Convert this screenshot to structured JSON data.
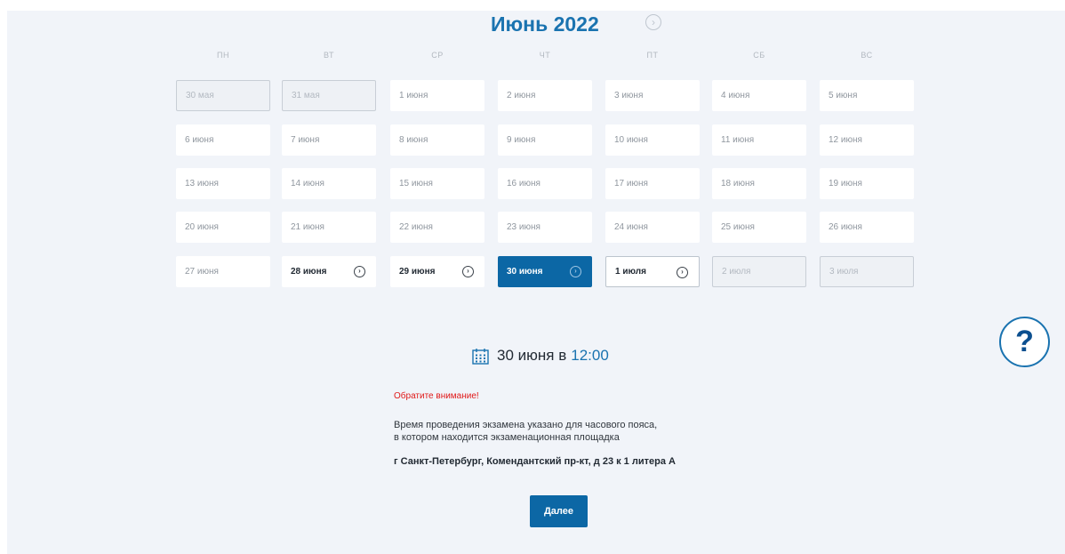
{
  "calendar": {
    "month_title": "Июнь 2022",
    "weekdays": [
      "ПН",
      "ВТ",
      "СР",
      "ЧТ",
      "ПТ",
      "СБ",
      "ВС"
    ],
    "weeks": [
      [
        {
          "label": "30 мая",
          "state": "disabled"
        },
        {
          "label": "31 мая",
          "state": "disabled"
        },
        {
          "label": "1 июня",
          "state": "unavailable"
        },
        {
          "label": "2 июня",
          "state": "unavailable"
        },
        {
          "label": "3 июня",
          "state": "unavailable"
        },
        {
          "label": "4 июня",
          "state": "unavailable"
        },
        {
          "label": "5 июня",
          "state": "unavailable"
        }
      ],
      [
        {
          "label": "6 июня",
          "state": "unavailable"
        },
        {
          "label": "7 июня",
          "state": "unavailable"
        },
        {
          "label": "8 июня",
          "state": "unavailable"
        },
        {
          "label": "9 июня",
          "state": "unavailable"
        },
        {
          "label": "10 июня",
          "state": "unavailable"
        },
        {
          "label": "11 июня",
          "state": "unavailable"
        },
        {
          "label": "12 июня",
          "state": "unavailable"
        }
      ],
      [
        {
          "label": "13 июня",
          "state": "unavailable"
        },
        {
          "label": "14 июня",
          "state": "unavailable"
        },
        {
          "label": "15 июня",
          "state": "unavailable"
        },
        {
          "label": "16 июня",
          "state": "unavailable"
        },
        {
          "label": "17 июня",
          "state": "unavailable"
        },
        {
          "label": "18 июня",
          "state": "unavailable"
        },
        {
          "label": "19 июня",
          "state": "unavailable"
        }
      ],
      [
        {
          "label": "20 июня",
          "state": "unavailable"
        },
        {
          "label": "21 июня",
          "state": "unavailable"
        },
        {
          "label": "22 июня",
          "state": "unavailable"
        },
        {
          "label": "23 июня",
          "state": "unavailable"
        },
        {
          "label": "24 июня",
          "state": "unavailable"
        },
        {
          "label": "25 июня",
          "state": "unavailable"
        },
        {
          "label": "26 июня",
          "state": "unavailable"
        }
      ],
      [
        {
          "label": "27 июня",
          "state": "unavailable"
        },
        {
          "label": "28 июня",
          "state": "available"
        },
        {
          "label": "29 июня",
          "state": "available"
        },
        {
          "label": "30 июня",
          "state": "selected"
        },
        {
          "label": "1 июля",
          "state": "available_next"
        },
        {
          "label": "2 июля",
          "state": "disabled"
        },
        {
          "label": "3 июля",
          "state": "disabled"
        }
      ]
    ]
  },
  "selection": {
    "date_text": "30 июня в",
    "time_text": "12:00"
  },
  "notice": {
    "title": "Обратите внимание!",
    "line1": "Время проведения экзамена указано для часового пояса,",
    "line2": "в котором находится экзаменационная площадка",
    "address": "г Санкт-Петербург, Комендантский пр-кт, д 23 к 1 литера А"
  },
  "actions": {
    "next_label": "Далее",
    "help_label": "?"
  },
  "colors": {
    "accent": "#0c67a5",
    "title": "#1a73b0",
    "warning": "#e01919",
    "background": "#f1f4f9"
  },
  "icons": {
    "month_next": "chevron-right-circle-icon",
    "day_arrow": "chevron-right-circle-icon",
    "calendar": "calendar-icon",
    "help": "question-mark-icon"
  }
}
